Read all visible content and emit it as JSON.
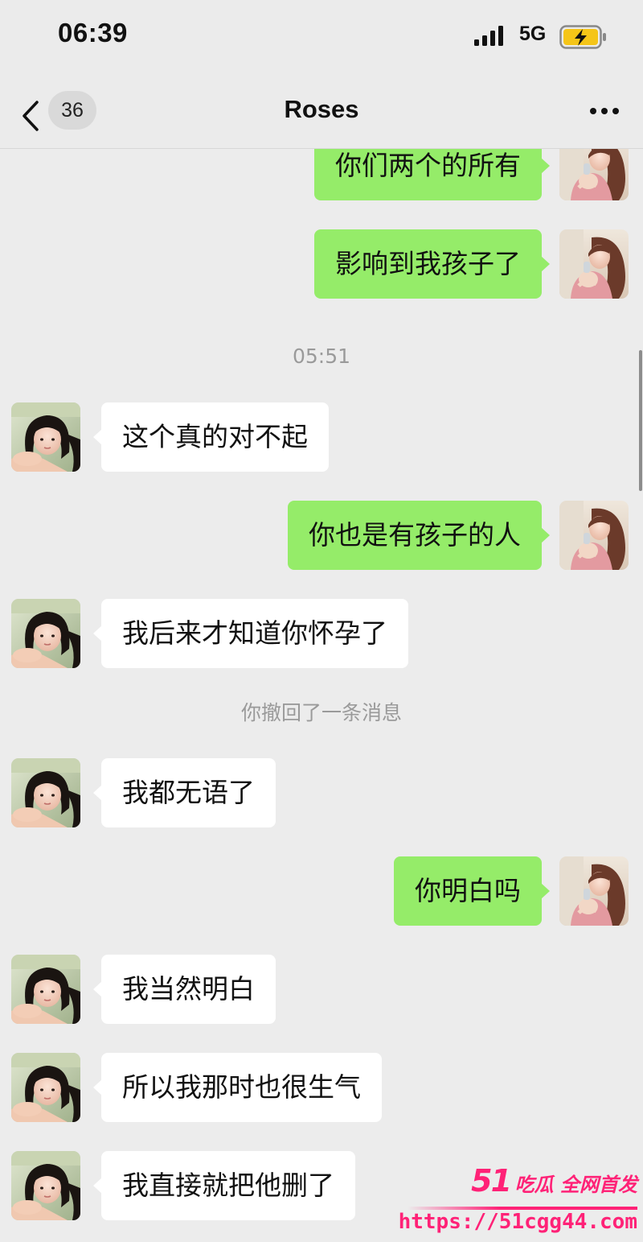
{
  "status_bar": {
    "time": "06:39",
    "network": "5G",
    "signal_icon": "signal-bars-icon",
    "battery_icon": "battery-charging-icon",
    "battery_color": "#f5c518"
  },
  "nav": {
    "back_icon": "chevron-left-icon",
    "unread_count": "36",
    "title": "Roses",
    "more_icon": "more-dots-icon"
  },
  "colors": {
    "background": "#ececec",
    "outgoing_bubble": "#95ec69",
    "incoming_bubble": "#ffffff",
    "system_text": "#9a9a9a",
    "watermark": "#ff2277"
  },
  "messages": [
    {
      "direction": "out",
      "text": "你们两个的所有"
    },
    {
      "direction": "out",
      "text": "影响到我孩子了"
    },
    {
      "type": "timestamp",
      "text": "05:51"
    },
    {
      "direction": "in",
      "text": "这个真的对不起"
    },
    {
      "direction": "out",
      "text": "你也是有孩子的人"
    },
    {
      "direction": "in",
      "text": "我后来才知道你怀孕了"
    },
    {
      "type": "system",
      "text": "你撤回了一条消息"
    },
    {
      "direction": "in",
      "text": "我都无语了"
    },
    {
      "direction": "out",
      "text": "你明白吗"
    },
    {
      "direction": "in",
      "text": "我当然明白"
    },
    {
      "direction": "in",
      "text": "所以我那时也很生气"
    },
    {
      "direction": "in",
      "text": "我直接就把他删了"
    }
  ],
  "watermark": {
    "number": "51",
    "text": "吃瓜 全网首发",
    "url": "https://51cgg44.com"
  }
}
